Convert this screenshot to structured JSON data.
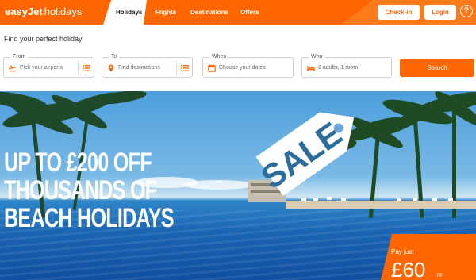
{
  "brand": {
    "name": "easyJet",
    "product": "holidays",
    "accent": "#ff6600"
  },
  "nav": {
    "items": [
      {
        "label": "Holidays",
        "active": true
      },
      {
        "label": "Flights",
        "active": false
      },
      {
        "label": "Destinations",
        "active": false
      },
      {
        "label": "Offers",
        "active": false
      }
    ]
  },
  "header": {
    "checkin_label": "Check-in",
    "login_label": "Login",
    "help_label": "?"
  },
  "search": {
    "title": "Find your perfect holiday",
    "from": {
      "label": "From",
      "placeholder": "Pick your airports",
      "icon": "plane-icon"
    },
    "to": {
      "label": "To",
      "placeholder": "Find destinations",
      "icon": "pin-icon"
    },
    "when": {
      "label": "When",
      "placeholder": "Choose your dates",
      "icon": "calendar-icon"
    },
    "who": {
      "label": "Who",
      "value": "2 adults, 1 room",
      "icon": "bed-icon"
    },
    "button_label": "Search"
  },
  "hero": {
    "headline": [
      "UP TO £200 OFF",
      "THOUSANDS OF",
      "BEACH HOLIDAYS"
    ],
    "tag_text": "SALE",
    "price_label": "Pay just",
    "price_value": "£60",
    "price_unit": "pp"
  }
}
